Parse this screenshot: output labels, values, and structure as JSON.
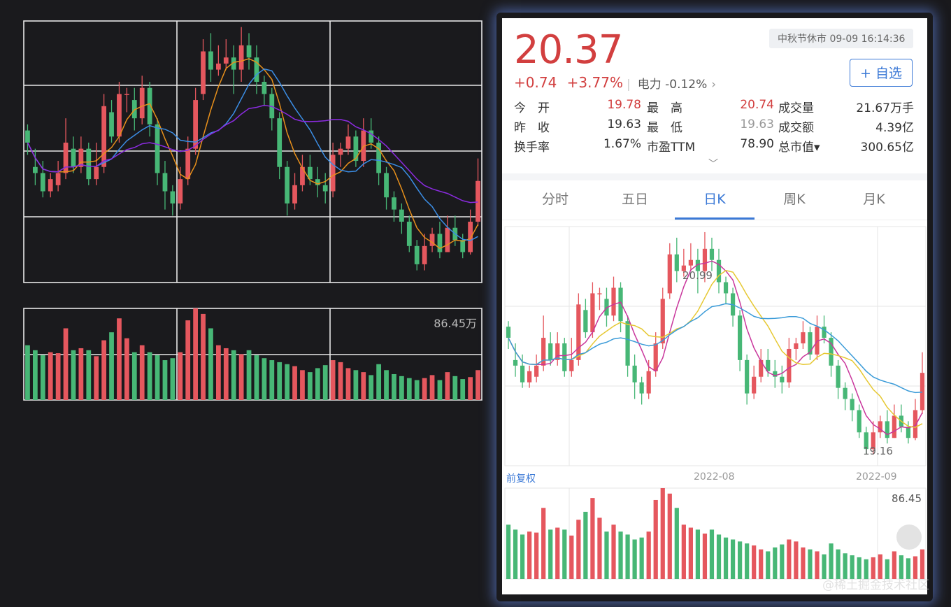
{
  "quote": {
    "price": "20.37",
    "change": "+0.74",
    "change_pct": "+3.77%",
    "sector_name": "电力",
    "sector_change": "-0.12%",
    "market_status": "中秋节休市 09-09 16:14:36",
    "favorite_label": "+ 自选"
  },
  "stats": {
    "open_label": "今　开",
    "open": "19.78",
    "high_label": "最　高",
    "high": "20.74",
    "volume_label": "成交量",
    "volume": "21.67万手",
    "prev_close_label": "昨　收",
    "prev_close": "19.63",
    "low_label": "最　低",
    "low": "19.63",
    "turnover_label": "成交额",
    "turnover": "4.39亿",
    "turnover_rate_label": "换手率",
    "turnover_rate": "1.67%",
    "pe_label": "市盈TTM",
    "pe": "78.90",
    "market_cap_label": "总市值▾",
    "market_cap": "300.65亿"
  },
  "tabs": [
    "分时",
    "五日",
    "日K",
    "周K",
    "月K"
  ],
  "active_tab": 2,
  "chart_labels": {
    "price_high": "20.99",
    "price_low": "19.16",
    "adj": "前复权",
    "dates": [
      "2022-08",
      "2022-09"
    ],
    "left_volume_max": "86.45万",
    "right_volume_max": "86.45"
  },
  "colors": {
    "up": "#e5575e",
    "down": "#47b776",
    "ma5": "#e8901b",
    "ma10": "#3b8ee6",
    "ma20": "#8b2be0"
  },
  "watermark": "@稀土掘金技术社区",
  "chart_data": {
    "type": "candlestick",
    "series_fields": [
      "open",
      "close",
      "high",
      "low",
      "volume_wan"
    ],
    "candles": [
      [
        21.2,
        21.0,
        21.3,
        20.8,
        55
      ],
      [
        20.6,
        20.5,
        20.9,
        20.3,
        50
      ],
      [
        20.5,
        20.2,
        20.7,
        20.1,
        45
      ],
      [
        20.2,
        20.4,
        20.5,
        20.1,
        48
      ],
      [
        20.3,
        20.5,
        20.7,
        20.2,
        47
      ],
      [
        20.5,
        21.0,
        21.4,
        20.4,
        72
      ],
      [
        20.9,
        20.6,
        21.1,
        20.5,
        50
      ],
      [
        20.6,
        20.9,
        21.1,
        20.5,
        52
      ],
      [
        20.9,
        20.4,
        21.0,
        20.3,
        50
      ],
      [
        20.4,
        20.6,
        21.0,
        20.3,
        44
      ],
      [
        20.6,
        21.6,
        21.8,
        20.5,
        60
      ],
      [
        21.5,
        21.1,
        21.7,
        21.0,
        68
      ],
      [
        21.1,
        21.8,
        22.0,
        21.0,
        82
      ],
      [
        21.8,
        21.8,
        21.9,
        21.5,
        62
      ],
      [
        21.7,
        21.4,
        21.9,
        21.2,
        48
      ],
      [
        21.4,
        21.9,
        22.1,
        21.3,
        55
      ],
      [
        21.9,
        21.3,
        22.0,
        21.1,
        48
      ],
      [
        21.3,
        20.5,
        21.4,
        20.3,
        45
      ],
      [
        20.5,
        20.2,
        20.7,
        19.9,
        40
      ],
      [
        20.2,
        20.0,
        20.3,
        19.8,
        42
      ],
      [
        20.0,
        20.4,
        20.6,
        19.9,
        48
      ],
      [
        20.4,
        20.9,
        21.1,
        20.3,
        80
      ],
      [
        20.9,
        21.7,
        21.9,
        20.8,
        92
      ],
      [
        21.8,
        22.5,
        22.7,
        21.7,
        86.45
      ],
      [
        22.5,
        22.2,
        22.8,
        22.0,
        72
      ],
      [
        22.2,
        22.3,
        22.6,
        22.1,
        55
      ],
      [
        22.3,
        22.4,
        22.7,
        22.2,
        52
      ],
      [
        22.4,
        22.2,
        22.6,
        21.8,
        50
      ],
      [
        22.2,
        22.6,
        22.9,
        22.0,
        46
      ],
      [
        22.6,
        22.4,
        22.8,
        22.2,
        50
      ],
      [
        22.4,
        22.0,
        22.6,
        21.8,
        45
      ],
      [
        22.0,
        21.8,
        22.1,
        21.6,
        42
      ],
      [
        21.8,
        21.4,
        21.9,
        21.2,
        40
      ],
      [
        21.4,
        20.6,
        21.5,
        20.4,
        38
      ],
      [
        20.6,
        20.0,
        20.7,
        19.8,
        36
      ],
      [
        20.0,
        20.3,
        20.5,
        19.9,
        34
      ],
      [
        20.3,
        20.6,
        20.8,
        20.2,
        30
      ],
      [
        20.6,
        20.4,
        20.8,
        20.3,
        28
      ],
      [
        20.4,
        20.3,
        20.6,
        20.1,
        32
      ],
      [
        20.3,
        20.2,
        20.5,
        20.0,
        35
      ],
      [
        20.2,
        20.8,
        21.0,
        20.1,
        40
      ],
      [
        20.8,
        20.9,
        21.0,
        20.6,
        38
      ],
      [
        20.9,
        21.1,
        21.3,
        20.8,
        32
      ],
      [
        21.1,
        20.7,
        21.2,
        20.6,
        30
      ],
      [
        20.7,
        21.2,
        21.4,
        20.6,
        28
      ],
      [
        21.2,
        21.0,
        21.4,
        20.9,
        25
      ],
      [
        21.0,
        20.5,
        21.1,
        20.3,
        36
      ],
      [
        20.5,
        20.1,
        20.6,
        19.9,
        30
      ],
      [
        20.1,
        19.9,
        20.2,
        19.7,
        26
      ],
      [
        19.9,
        19.7,
        20.0,
        19.5,
        24
      ],
      [
        19.7,
        19.3,
        19.8,
        19.2,
        22
      ],
      [
        19.3,
        19.0,
        19.4,
        18.9,
        20
      ],
      [
        19.0,
        19.3,
        19.5,
        18.9,
        22
      ],
      [
        19.3,
        19.5,
        19.6,
        19.2,
        25
      ],
      [
        19.5,
        19.2,
        19.7,
        19.1,
        20
      ],
      [
        19.2,
        19.6,
        19.8,
        19.2,
        28
      ],
      [
        19.6,
        19.4,
        19.8,
        19.3,
        24
      ],
      [
        19.4,
        19.2,
        19.5,
        19.1,
        21
      ],
      [
        19.2,
        19.7,
        19.9,
        19.16,
        23
      ],
      [
        19.7,
        20.37,
        20.74,
        19.63,
        30
      ]
    ]
  }
}
